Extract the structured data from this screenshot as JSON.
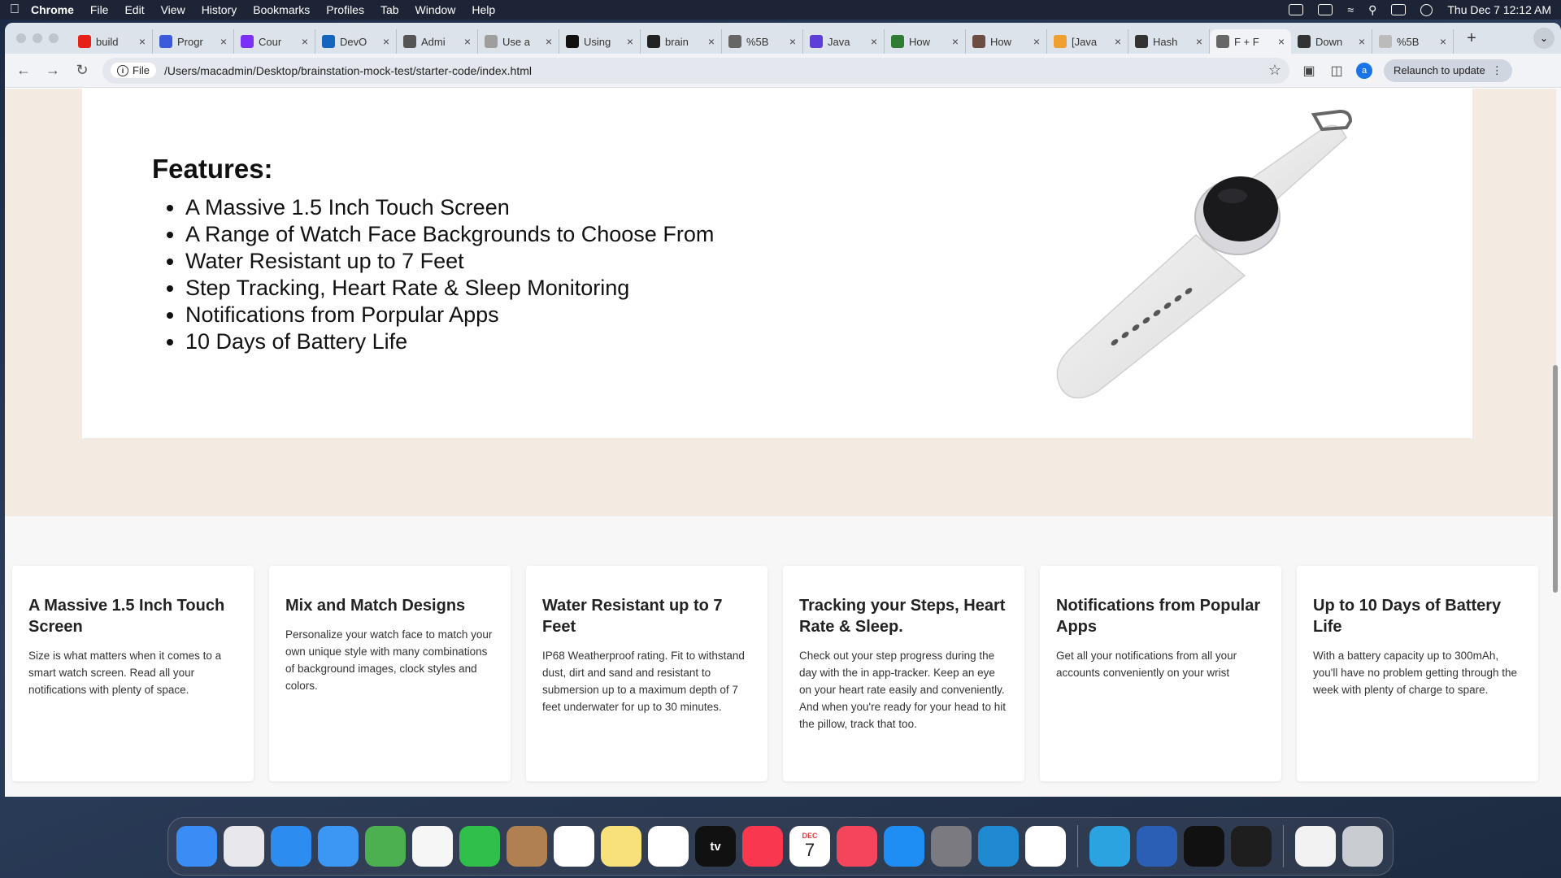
{
  "menubar": {
    "app_name": "Chrome",
    "menus": [
      "File",
      "Edit",
      "View",
      "History",
      "Bookmarks",
      "Profiles",
      "Tab",
      "Window",
      "Help"
    ],
    "clock": "Thu Dec 7  12:12 AM"
  },
  "tabs": [
    {
      "label": "build",
      "icon_color": "#e62117"
    },
    {
      "label": "Progr",
      "icon_color": "#3b5bdb"
    },
    {
      "label": "Cour",
      "icon_color": "#7b2ff7"
    },
    {
      "label": "DevO",
      "icon_color": "#1565c0"
    },
    {
      "label": "Admi",
      "icon_color": "#555555"
    },
    {
      "label": "Use a",
      "icon_color": "#9e9e9e"
    },
    {
      "label": "Using",
      "icon_color": "#111111"
    },
    {
      "label": "brain",
      "icon_color": "#222222"
    },
    {
      "label": "%5B",
      "icon_color": "#666666"
    },
    {
      "label": "Java",
      "icon_color": "#5b3fd6"
    },
    {
      "label": "How",
      "icon_color": "#2e7d32"
    },
    {
      "label": "How",
      "icon_color": "#6d4c41"
    },
    {
      "label": "[Java",
      "icon_color": "#f0a030"
    },
    {
      "label": "Hash",
      "icon_color": "#333333"
    },
    {
      "label": "F + F",
      "icon_color": "#666666",
      "active": true
    },
    {
      "label": "Down",
      "icon_color": "#333333"
    },
    {
      "label": "%5B",
      "icon_color": "#bbbbbb"
    }
  ],
  "toolbar": {
    "file_chip": "File",
    "url": "/Users/macadmin/Desktop/brainstation-mock-test/starter-code/index.html",
    "profile_initial": "a",
    "relaunch_label": "Relaunch to update"
  },
  "page": {
    "features_title": "Features:",
    "features": [
      "A Massive 1.5 Inch Touch Screen",
      "A Range of Watch Face Backgrounds to Choose From",
      "Water Resistant up to 7 Feet",
      "Step Tracking, Heart Rate & Sleep Monitoring",
      "Notifications from Porpular Apps",
      "10 Days of Battery Life"
    ],
    "cards": [
      {
        "title": "A Massive 1.5 Inch Touch Screen",
        "body": "Size is what matters when it comes to a smart watch screen. Read all your notifications with plenty of space."
      },
      {
        "title": "Mix and Match Designs",
        "body": "Personalize your watch face to match your own unique style with many combinations of background images, clock styles and colors."
      },
      {
        "title": "Water Resistant up to 7 Feet",
        "body": "IP68 Weatherproof rating. Fit to withstand dust, dirt and sand and resistant to submersion up to a maximum depth of 7 feet underwater for up to 30 minutes."
      },
      {
        "title": "Tracking your Steps, Heart Rate & Sleep.",
        "body": "Check out your step progress during the day with the in app-tracker. Keep an eye on your heart rate easily and conveniently. And when you're ready for your head to hit the pillow, track that too."
      },
      {
        "title": "Notifications from Popular Apps",
        "body": "Get all your notifications from all your accounts conveniently on your wrist"
      },
      {
        "title": "Up to 10 Days of Battery Life",
        "body": "With a battery capacity up to 300mAh, you'll have no problem getting through the week with plenty of charge to spare."
      }
    ]
  },
  "dock": {
    "calendar_month": "DEC",
    "calendar_day": "7",
    "tv_label": "tv",
    "apps": [
      {
        "name": "finder",
        "color": "#3a8df5"
      },
      {
        "name": "launchpad",
        "color": "#e8e8ec"
      },
      {
        "name": "safari",
        "color": "#2d8cf0"
      },
      {
        "name": "mail",
        "color": "#3b97f3"
      },
      {
        "name": "maps",
        "color": "#4caf50"
      },
      {
        "name": "photos",
        "color": "#f6f6f6"
      },
      {
        "name": "facetime",
        "color": "#2fbf4a"
      },
      {
        "name": "contacts",
        "color": "#b08050"
      },
      {
        "name": "reminders",
        "color": "#ffffff"
      },
      {
        "name": "notes",
        "color": "#f8e07a"
      },
      {
        "name": "freeform",
        "color": "#ffffff"
      },
      {
        "name": "apple-tv",
        "color": "#111111"
      },
      {
        "name": "music",
        "color": "#f9384f"
      },
      {
        "name": "calendar",
        "color": "#ffffff"
      },
      {
        "name": "news",
        "color": "#f5455c"
      },
      {
        "name": "app-store",
        "color": "#1e8ef5"
      },
      {
        "name": "system-settings",
        "color": "#7a7a80"
      },
      {
        "name": "vscode",
        "color": "#1f8ad2"
      },
      {
        "name": "chrome",
        "color": "#ffffff"
      },
      {
        "name": "telegram",
        "color": "#2aa3e0"
      },
      {
        "name": "word",
        "color": "#2b5eb5"
      },
      {
        "name": "intellij",
        "color": "#111111"
      },
      {
        "name": "terminal",
        "color": "#1e1e1e"
      },
      {
        "name": "document",
        "color": "#f2f2f2"
      },
      {
        "name": "trash",
        "color": "#c9ccd1"
      }
    ]
  }
}
